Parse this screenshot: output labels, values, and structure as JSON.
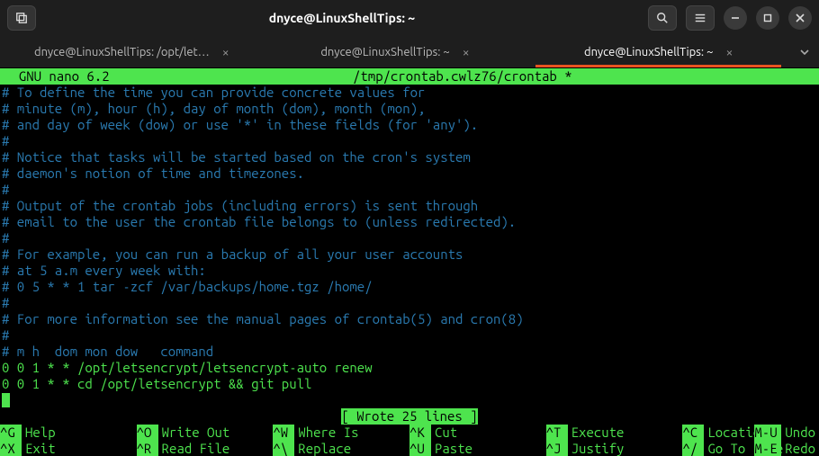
{
  "titlebar": {
    "title": "dnyce@LinuxShellTips: ~"
  },
  "tabs": {
    "items": [
      {
        "label": "dnyce@LinuxShellTips: /opt/let…",
        "active": false
      },
      {
        "label": "dnyce@LinuxShellTips: ~",
        "active": false
      },
      {
        "label": "dnyce@LinuxShellTips: ~",
        "active": true
      }
    ]
  },
  "nano": {
    "app": "  GNU nano 6.2",
    "file": "/tmp/crontab.cwlz76/crontab *",
    "status": "[ Wrote 25 lines ]"
  },
  "lines": [
    {
      "t": "c",
      "s": "# To define the time you can provide concrete values for"
    },
    {
      "t": "c",
      "s": "# minute (m), hour (h), day of month (dom), month (mon),"
    },
    {
      "t": "c",
      "s": "# and day of week (dow) or use '*' in these fields (for 'any')."
    },
    {
      "t": "c",
      "s": "#"
    },
    {
      "t": "c",
      "s": "# Notice that tasks will be started based on the cron's system"
    },
    {
      "t": "c",
      "s": "# daemon's notion of time and timezones."
    },
    {
      "t": "c",
      "s": "#"
    },
    {
      "t": "c",
      "s": "# Output of the crontab jobs (including errors) is sent through"
    },
    {
      "t": "c",
      "s": "# email to the user the crontab file belongs to (unless redirected)."
    },
    {
      "t": "c",
      "s": "#"
    },
    {
      "t": "c",
      "s": "# For example, you can run a backup of all your user accounts"
    },
    {
      "t": "c",
      "s": "# at 5 a.m every week with:"
    },
    {
      "t": "c",
      "s": "# 0 5 * * 1 tar -zcf /var/backups/home.tgz /home/"
    },
    {
      "t": "c",
      "s": "#"
    },
    {
      "t": "c",
      "s": "# For more information see the manual pages of crontab(5) and cron(8)"
    },
    {
      "t": "c",
      "s": "#"
    },
    {
      "t": "c",
      "s": "# m h  dom mon dow   command"
    },
    {
      "t": "g",
      "s": "0 0 1 * * /opt/letsencrypt/letsencrypt-auto renew"
    },
    {
      "t": "g",
      "s": "0 0 1 * * cd /opt/letsencrypt && git pull"
    }
  ],
  "footer": {
    "row1": [
      {
        "key": "^G",
        "label": "Help"
      },
      {
        "key": "^O",
        "label": "Write Out"
      },
      {
        "key": "^W",
        "label": "Where Is"
      },
      {
        "key": "^K",
        "label": "Cut"
      },
      {
        "key": "^T",
        "label": "Execute"
      },
      {
        "key": "^C",
        "label": "Location"
      }
    ],
    "row1_extra": {
      "key": "M-U",
      "label": "Undo"
    },
    "row2": [
      {
        "key": "^X",
        "label": "Exit"
      },
      {
        "key": "^R",
        "label": "Read File"
      },
      {
        "key": "^\\",
        "label": "Replace"
      },
      {
        "key": "^U",
        "label": "Paste"
      },
      {
        "key": "^J",
        "label": "Justify"
      },
      {
        "key": "^/",
        "label": "Go To Line"
      }
    ],
    "row2_extra": {
      "key": "M-E",
      "label": "Redo"
    }
  }
}
